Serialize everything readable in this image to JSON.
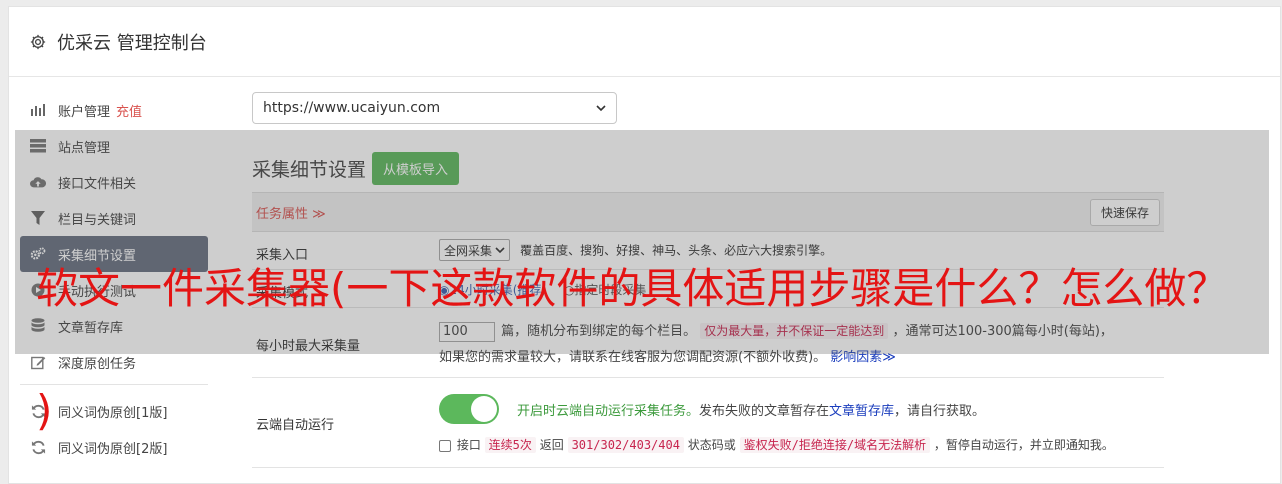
{
  "header": {
    "title": "优采云 管理控制台",
    "icon": "gear-icon"
  },
  "sidebar": {
    "items": [
      {
        "label": "账户管理",
        "extra": "充值",
        "icon": "bar-chart-icon"
      },
      {
        "label": "站点管理",
        "icon": "server-icon"
      },
      {
        "label": "接口文件相关",
        "icon": "cloud-upload-icon"
      },
      {
        "label": "栏目与关键词",
        "icon": "filter-icon"
      },
      {
        "label": "采集细节设置",
        "icon": "gears-icon",
        "active": true
      },
      {
        "label": "手动执行测试",
        "icon": "play-icon"
      },
      {
        "label": "文章暂存库",
        "icon": "database-icon"
      },
      {
        "label": "深度原创任务",
        "icon": "edit-icon"
      },
      {
        "label": "同义词伪原创[1版]",
        "icon": "refresh-icon"
      },
      {
        "label": "同义词伪原创[2版]",
        "icon": "refresh-icon"
      }
    ]
  },
  "site_select": {
    "value": "https://www.ucaiyun.com"
  },
  "section": {
    "title": "采集细节设置",
    "template_button": "从模板导入"
  },
  "task_bar": {
    "attr_label": "任务属性 ≫",
    "quick_save": "快速保存"
  },
  "rows": {
    "entry": {
      "label": "采集入口",
      "select_value": "全网采集",
      "desc": "覆盖百度、搜狗、好搜、神马、头条、必应六大搜索引擎。"
    },
    "mode": {
      "label": "采集模式",
      "option_a": "◉24小时采集(推荐)",
      "option_b": "○指定时段采集"
    },
    "max": {
      "label": "每小时最大采集量",
      "value": "100",
      "text1": "篇，随机分布到绑定的每个栏目。",
      "tag": "仅为最大量，并不保证一定能达到",
      "text2": "，通常可达100-300篇每小时(每站)，",
      "text3": "如果您的需求量较大，请联系在线客服为您调配资源(不额外收费)。",
      "link": "影响因素≫"
    },
    "cloud": {
      "label": "云端自动运行",
      "toggle_on": true,
      "green": "开启时云端自动运行采集任务。",
      "text1": "发布失败的文章暂存在",
      "link": "文章暂存库",
      "text2": "，请自行获取。",
      "chk_label": "接口",
      "tag1": "连续5次",
      "text3": "返回",
      "tag2": "301/302/403/404",
      "text4": "状态码或",
      "tag3": "鉴权失败/拒绝连接/域名无法解析",
      "text5": "，暂停自动运行，并立即通知我。"
    }
  },
  "overlay": {
    "line1": "软文一件采集器(一下这款软件的具体适用步骤是什么？怎么做？",
    "line2": ")"
  },
  "colors": {
    "accent_green": "#5cb85c",
    "active_item": "#677080",
    "red": "#d9534f",
    "overlay_text": "#e41414"
  }
}
